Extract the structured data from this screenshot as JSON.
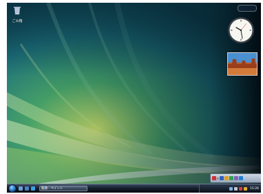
{
  "desktop": {
    "icons": [
      {
        "label": "ごみ箱",
        "icon": "recycle-bin-icon"
      }
    ]
  },
  "taskbar": {
    "task_button_label": "無題 - ペイント",
    "clock": "15:26"
  },
  "colors": {
    "taskbar": "#0b111b",
    "start_orb": "#2e7cc9",
    "wallpaper_dark": "#0b3a40",
    "wallpaper_glow": "#e6f29a"
  }
}
